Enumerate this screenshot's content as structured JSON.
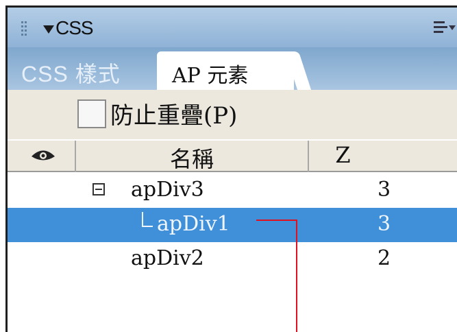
{
  "panel": {
    "title": "CSS",
    "tabs": [
      {
        "label": "CSS 樣式",
        "active": false
      },
      {
        "label": "AP 元素",
        "active": true
      }
    ],
    "prevent_overlap": {
      "label": "防止重疊(P)",
      "checked": false
    }
  },
  "table": {
    "columns": {
      "visibility_icon": "eye-icon",
      "name": "名稱",
      "z": "Z"
    },
    "rows": [
      {
        "name": "apDiv3",
        "z": "3",
        "expanded": true,
        "selected": false
      },
      {
        "name": "apDiv1",
        "z": "3",
        "child": true,
        "selected": true
      },
      {
        "name": "apDiv2",
        "z": "2",
        "selected": false
      }
    ]
  },
  "colors": {
    "selection": "#3f8fd9",
    "titlebar": "#9dbfe0",
    "callout": "#e01020"
  }
}
